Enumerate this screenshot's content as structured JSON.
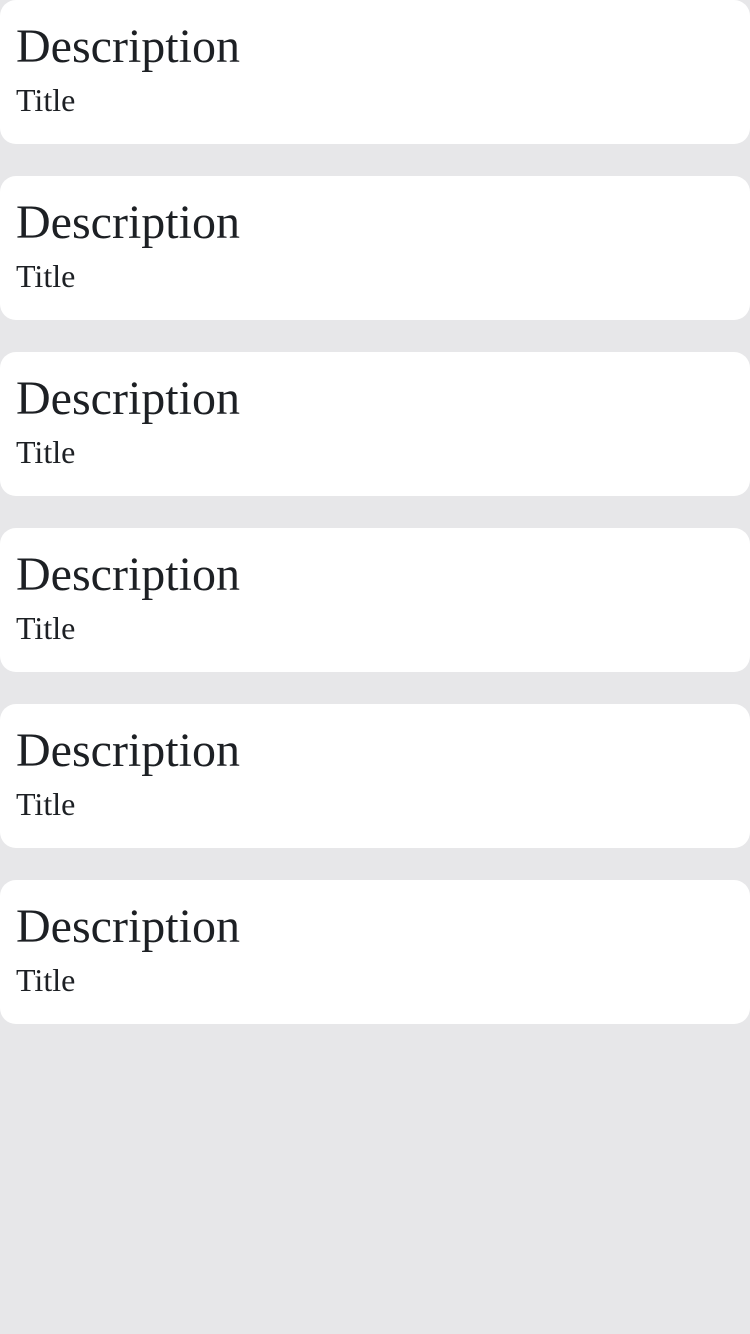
{
  "cards": [
    {
      "description": "Description",
      "title": "Title"
    },
    {
      "description": "Description",
      "title": "Title"
    },
    {
      "description": "Description",
      "title": "Title"
    },
    {
      "description": "Description",
      "title": "Title"
    },
    {
      "description": "Description",
      "title": "Title"
    },
    {
      "description": "Description",
      "title": "Title"
    }
  ]
}
